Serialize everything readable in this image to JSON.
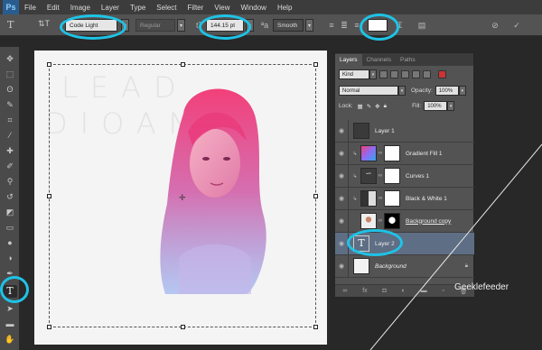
{
  "app": {
    "logo": "Ps"
  },
  "menu": [
    "File",
    "Edit",
    "Image",
    "Layer",
    "Type",
    "Select",
    "Filter",
    "View",
    "Window",
    "Help"
  ],
  "options_bar": {
    "tool_icon": "type-tool-icon",
    "font_family": "Code Light",
    "font_style": "Regular",
    "font_size": "144.15 pt",
    "antialias": "Smooth",
    "text_color": "#ffffff"
  },
  "document": {
    "ghost_line1": "LEAD",
    "ghost_line2": "DIOAN"
  },
  "layers_panel": {
    "tabs": [
      "Layers",
      "Channels",
      "Paths"
    ],
    "filter_kind": "Kind",
    "blend_mode": "Normal",
    "opacity_label": "Opacity:",
    "opacity_value": "100%",
    "lock_label": "Lock:",
    "fill_label": "Fill:",
    "fill_value": "100%",
    "layers": [
      {
        "name": "Layer 1",
        "type": "pixel"
      },
      {
        "name": "Gradient Fill 1",
        "type": "gradient"
      },
      {
        "name": "Curves 1",
        "type": "curves"
      },
      {
        "name": "Black & White 1",
        "type": "bw"
      },
      {
        "name": "Background copy",
        "type": "masked"
      },
      {
        "name": "Layer 2",
        "type": "text",
        "selected": true
      },
      {
        "name": "Background",
        "type": "background",
        "locked": true
      }
    ]
  },
  "watermark": "Geeklefeeder",
  "colors": {
    "highlight": "#1ec3e6",
    "selection": "#5e6e84",
    "ui_bg": "#535353"
  }
}
